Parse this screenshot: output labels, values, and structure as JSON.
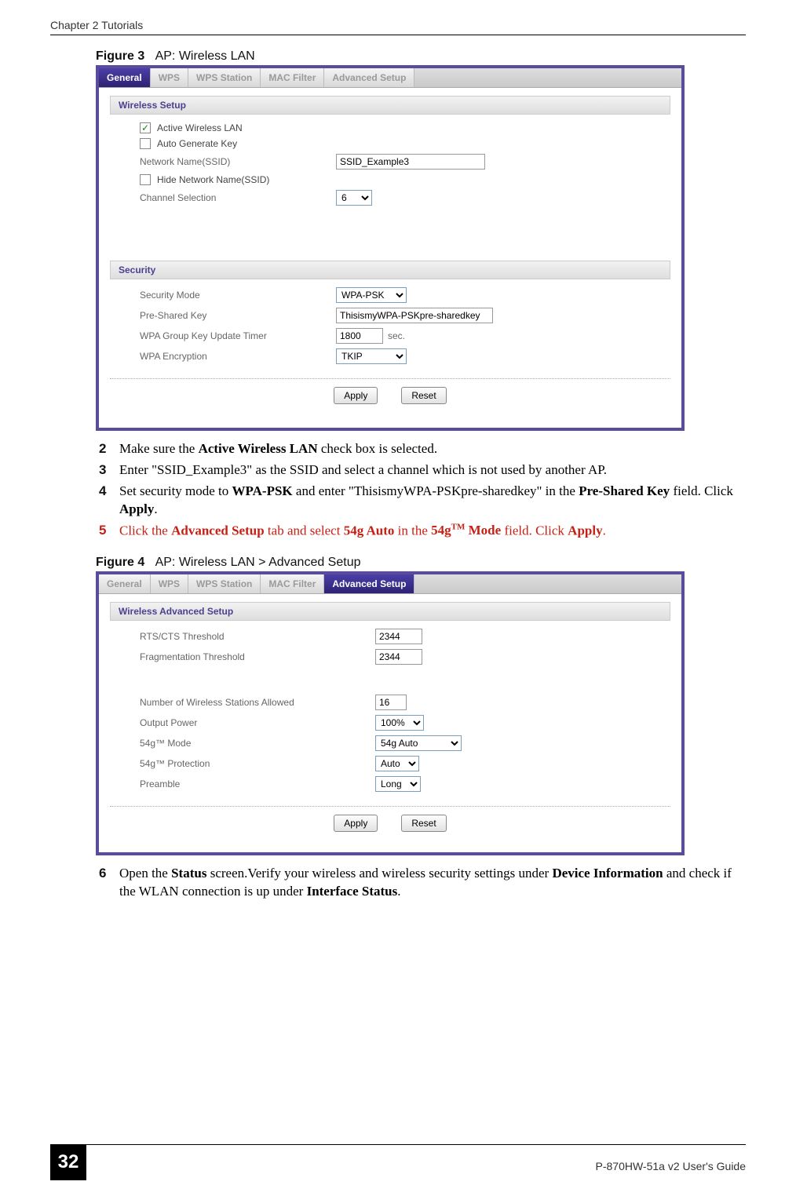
{
  "header": {
    "chapter": "Chapter 2 Tutorials"
  },
  "figure3": {
    "caption_prefix": "Figure 3",
    "caption_text": "AP: Wireless LAN"
  },
  "general_panel": {
    "tabs": [
      "General",
      "WPS",
      "WPS Station",
      "MAC Filter",
      "Advanced Setup"
    ],
    "section_wireless": "Wireless Setup",
    "active_wlan_label": "Active Wireless LAN",
    "auto_gen_label": "Auto Generate Key",
    "network_name_label": "Network Name(SSID)",
    "network_name_value": "SSID_Example3",
    "hide_ssid_label": "Hide Network Name(SSID)",
    "channel_label": "Channel Selection",
    "channel_value": "6",
    "section_security": "Security",
    "sec_mode_label": "Security Mode",
    "sec_mode_value": "WPA-PSK",
    "psk_label": "Pre-Shared Key",
    "psk_value": "ThisismyWPA-PSKpre-sharedkey",
    "gkt_label": "WPA Group Key Update Timer",
    "gkt_value": "1800",
    "gkt_suffix": "sec.",
    "enc_label": "WPA Encryption",
    "enc_value": "TKIP",
    "apply": "Apply",
    "reset": "Reset"
  },
  "steps_a": {
    "s2": "Make sure the Active Wireless LAN check box is selected.",
    "s3": "Enter \"SSID_Example3\" as the SSID and select a channel which is not used by another AP.",
    "s4_pre": "Set security mode to ",
    "s4_b1": "WPA-PSK",
    "s4_mid": " and enter \"ThisismyWPA-PSKpre-sharedkey\" in the ",
    "s4_b2": "Pre-Shared Key",
    "s4_mid2": " field. Click ",
    "s4_b3": "Apply",
    "s4_end": ".",
    "s5_pre": "Click the ",
    "s5_b1": "Advanced Setup",
    "s5_mid": " tab and select ",
    "s5_b2": "54g Auto",
    "s5_mid2": " in the ",
    "s5_b3_pre": "54g",
    "s5_b3_sup": "TM",
    "s5_b3_post": " Mode",
    "s5_mid3": " field. Click ",
    "s5_b4": "Apply",
    "s5_end": "."
  },
  "figure4": {
    "caption_prefix": "Figure 4",
    "caption_text": "AP: Wireless LAN > Advanced Setup"
  },
  "advanced_panel": {
    "tabs": [
      "General",
      "WPS",
      "WPS Station",
      "MAC Filter",
      "Advanced Setup"
    ],
    "section": "Wireless Advanced Setup",
    "rts_label": "RTS/CTS  Threshold",
    "rts_value": "2344",
    "frag_label": "Fragmentation  Threshold",
    "frag_value": "2344",
    "stations_label": "Number of Wireless Stations Allowed",
    "stations_value": "16",
    "output_label": "Output Power",
    "output_value": "100%",
    "mode54_label": "54g™ Mode",
    "mode54_value": "54g Auto",
    "prot54_label": "54g™ Protection",
    "prot54_value": "Auto",
    "preamble_label": "Preamble",
    "preamble_value": "Long",
    "apply": "Apply",
    "reset": "Reset"
  },
  "steps_b": {
    "s6_pre": "Open the ",
    "s6_b1": "Status",
    "s6_mid": " screen.Verify your wireless and wireless security settings under ",
    "s6_b2": "Device Information",
    "s6_mid2": " and check if the WLAN connection is up under ",
    "s6_b3": "Interface Status",
    "s6_end": "."
  },
  "footer": {
    "page": "32",
    "guide": "P-870HW-51a v2 User's Guide"
  }
}
